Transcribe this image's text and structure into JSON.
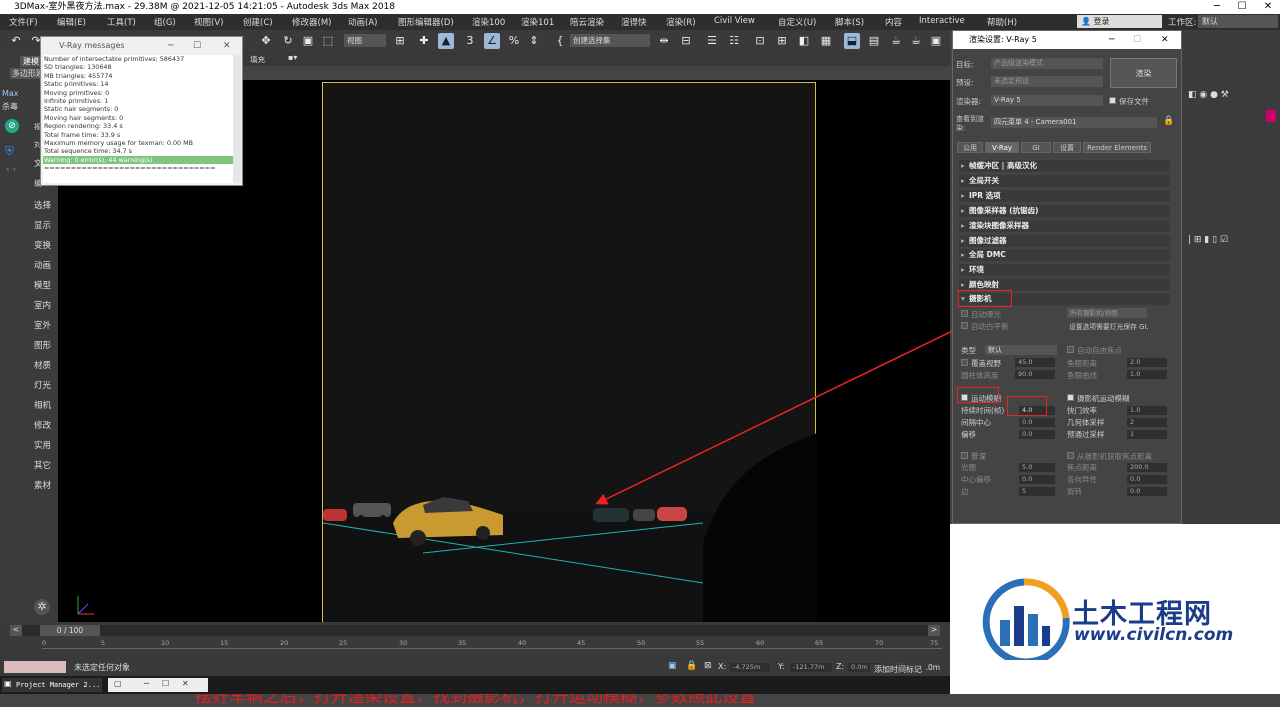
{
  "titlebar": {
    "title": "3DMax-室外黑夜方法.max - 29.38M @ 2021-12-05 14:21:05 - Autodesk 3ds Max 2018",
    "minimize": "─",
    "maximize": "☐",
    "close": "✕"
  },
  "menubar": {
    "items": [
      "文件(F)",
      "编辑(E)",
      "工具(T)",
      "组(G)",
      "视图(V)",
      "创建(C)",
      "修改器(M)",
      "动画(A)",
      "图形编辑器(D)",
      "渲染100",
      "渲染101",
      "陪云渲染",
      "渲得快",
      "渲染(R)",
      "Civil View",
      "自定义(U)",
      "脚本(S)",
      "内容",
      "Interactive",
      "帮助(H)"
    ],
    "login": "登录",
    "workspace_label": "工作区:",
    "workspace_value": "默认"
  },
  "toolbar": {
    "view_dropdown": "视图",
    "selection_set": "创建选择集",
    "panel_label": "填充"
  },
  "left_panel": {
    "tabs": [
      "建模",
      "多边形建"
    ],
    "app_short": "Max",
    "app_sub": "杀毒",
    "items": [
      "选择",
      "显示",
      "变换",
      "动画",
      "模型",
      "室内",
      "室外",
      "图形",
      "材质",
      "灯光",
      "相机",
      "修改",
      "实用",
      "其它",
      "素材"
    ],
    "sub_labels": [
      "视",
      "刘",
      "文",
      "编"
    ]
  },
  "vray_messages": {
    "title": "V-Ray messages",
    "lines": [
      "Number of intersectable primitives: 586437",
      "SD triangles: 130648",
      "MB triangles: 455774",
      "Static primitives: 14",
      "Moving primitives: 0",
      "Infinite primitives: 1",
      "Static hair segments: 0",
      "Moving hair segments: 0",
      "Region rendering: 33.4 s",
      "Total frame time: 33.9 s",
      "Maximum memory usage for texman: 0.00 MB",
      "Total sequence time: 34.7 s"
    ],
    "warning_line": "Warning: 0 error(s), 44 warning(s)",
    "separator": "================================"
  },
  "render_setup": {
    "title": "渲染设置: V-Ray 5",
    "target_label": "目标:",
    "target_value": "产品级渲染模式",
    "preset_label": "预设:",
    "preset_value": "未选定预设",
    "renderer_label": "渲染器:",
    "renderer_value": "V-Ray 5",
    "save_file": "保存文件",
    "render_button": "渲染",
    "view_label": "查看到渲染:",
    "view_value": "四元菜单 4 - Camera001",
    "tabs": [
      "公用",
      "V-Ray",
      "GI",
      "设置",
      "Render Elements"
    ],
    "rollouts": [
      "帧缓冲区 | 高级汉化",
      "全局开关",
      "IPR 选项",
      "图像采样器 (抗锯齿)",
      "渲染块图像采样器",
      "图像过滤器",
      "全局 DMC",
      "环境",
      "颜色映射",
      "摄影机"
    ],
    "camera": {
      "auto_exposure": "自动曝光",
      "auto_wb": "自动白平衡",
      "all_cams": "所有摄影机/视图",
      "sv_note": "设置选项需要灯光保存 GI.",
      "type_label": "类型",
      "type_value": "默认",
      "auto_focus": "自动自由焦点",
      "override_fov": "覆盖视野",
      "fov_value": "45.0",
      "cyl_height": "圆柱体高度",
      "cyl_value": "90.0",
      "fisheye_dist": "鱼眼距离",
      "fisheye_dist_value": "2.0",
      "fisheye_curve": "鱼眼曲线",
      "fisheye_curve_value": "1.0",
      "motion_blur": "运动模糊",
      "cam_motion_blur": "摄影机运动模糊",
      "duration_label": "持续时间(帧)",
      "duration_value": "4.0",
      "shutter_eff": "快门效率",
      "shutter_eff_value": "1.0",
      "interval_center": "间隔中心",
      "interval_value": "0.0",
      "geo_samples": "几何体采样",
      "geo_samples_value": "2",
      "bias": "偏移",
      "bias_value": "0.0",
      "prepass_samples": "预通过采样",
      "prepass_value": "1",
      "dof": "景深",
      "from_cam": "从摄影机获取焦点距离",
      "aperture": "光圈",
      "aperture_value": "5.0",
      "focal_dist": "焦点距离",
      "focal_dist_value": "200.0",
      "center_bias": "中心偏移",
      "center_bias_value": "0.0",
      "anisotropy": "各向异性",
      "anisotropy_value": "0.0",
      "sides": "边",
      "sides_value": "5",
      "rotation": "旋转",
      "rotation_value": "0.0"
    }
  },
  "timeline": {
    "frame_readout": "0 / 100",
    "ticks": [
      "0",
      "5",
      "10",
      "15",
      "20",
      "25",
      "30",
      "35",
      "40",
      "45",
      "50",
      "55",
      "60",
      "65",
      "70",
      "75",
      "80",
      "85",
      "90",
      "95",
      "100"
    ]
  },
  "status": {
    "message": "未选定任何对象",
    "x_label": "X:",
    "x_value": "-4.725m",
    "y_label": "Y:",
    "y_value": "-121.77m",
    "z_label": "Z:",
    "z_value": "0.0m",
    "grid": "栅格 = 10.0m",
    "add_marker": "添加时间标记"
  },
  "taskbar": {
    "item": "Project Manager 2..."
  },
  "caption": "摆好车辆之后，打开渲染设置，找到摄影机，打开运动模糊，参数照此设置",
  "watermark": {
    "name": "土木工程网",
    "url": "www.civilcn.com"
  },
  "colors": {
    "accent_red": "#e02020",
    "camera_frame": "#d6c03b",
    "logo_blue": "#1a3c8a"
  }
}
